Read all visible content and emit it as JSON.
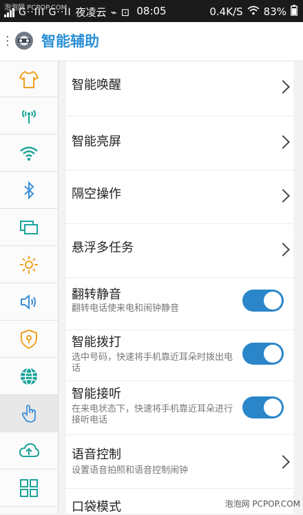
{
  "status_bar": {
    "carrier": "G··III G··II",
    "watermark": "泡泡网 PCPOP.COM",
    "notification": "夜凌云",
    "time": "08:05",
    "speed": "0.4K/S",
    "battery": "83%"
  },
  "header": {
    "title": "智能辅助"
  },
  "sidebar": {
    "items": [
      {
        "icon": "shirt-icon"
      },
      {
        "icon": "antenna-icon"
      },
      {
        "icon": "wifi-icon"
      },
      {
        "icon": "bluetooth-icon"
      },
      {
        "icon": "screens-icon"
      },
      {
        "icon": "brightness-icon"
      },
      {
        "icon": "volume-icon"
      },
      {
        "icon": "shield-lock-icon"
      },
      {
        "icon": "globe-icon"
      },
      {
        "icon": "hand-gesture-icon"
      },
      {
        "icon": "cloud-upload-icon"
      },
      {
        "icon": "grid-icon"
      }
    ],
    "active_index": 9
  },
  "settings": {
    "smart_wake": "智能唤醒",
    "smart_screen": "智能亮屏",
    "air_gesture": "隔空操作",
    "floating_multitask": "悬浮多任务",
    "flip_mute": {
      "label": "翻转静音",
      "sub": "翻转电话使来电和闹钟静音",
      "on": true
    },
    "smart_dial": {
      "label": "智能拨打",
      "sub": "选中号码，快速将手机靠近耳朵时拨出电话",
      "on": true
    },
    "smart_answer": {
      "label": "智能接听",
      "sub": "在来电状态下，快速将手机靠近耳朵进行接听电话",
      "on": true
    },
    "voice_control": {
      "label": "语音控制",
      "sub": "设置语音拍照和语音控制闹钟"
    },
    "pocket_mode": "口袋模式"
  },
  "footer_watermark": "泡泡网 PCPOP.COM",
  "colors": {
    "accent": "#2a8fd6",
    "toggle_on": "#2b86c9",
    "icon_teal": "#1aa39a"
  }
}
